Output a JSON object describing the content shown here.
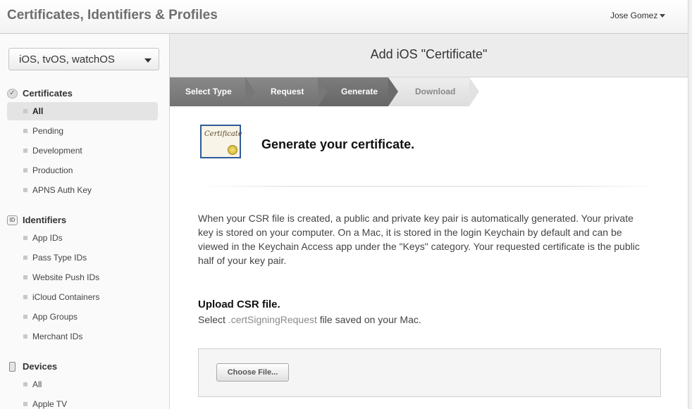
{
  "header": {
    "title": "Certificates, Identifiers & Profiles",
    "user": "Jose Gomez"
  },
  "sidebar": {
    "platform": "iOS, tvOS, watchOS",
    "certificates": {
      "label": "Certificates",
      "icon": "certificate-check-icon",
      "items": [
        "All",
        "Pending",
        "Development",
        "Production",
        "APNS Auth Key"
      ],
      "active": "All"
    },
    "identifiers": {
      "label": "Identifiers",
      "icon_text": "ID",
      "items": [
        "App IDs",
        "Pass Type IDs",
        "Website Push IDs",
        "iCloud Containers",
        "App Groups",
        "Merchant IDs"
      ]
    },
    "devices": {
      "label": "Devices",
      "icon": "device-icon",
      "items": [
        "All",
        "Apple TV"
      ]
    }
  },
  "main": {
    "title": "Add iOS \"Certificate\"",
    "steps": [
      "Select Type",
      "Request",
      "Generate",
      "Download"
    ],
    "current_step": "Generate",
    "cert_icon_text": "Certificate",
    "heading": "Generate your certificate.",
    "description": "When your CSR file is created, a public and private key pair is automatically generated. Your private key is stored on your computer. On a Mac, it is stored in the login Keychain by default and can be viewed in the Keychain Access app under the \"Keys\" category. Your requested certificate is the public half of your key pair.",
    "upload_heading": "Upload CSR file.",
    "upload_sub_prefix": "Select ",
    "upload_sub_code": ".certSigningRequest",
    "upload_sub_suffix": " file saved on your Mac.",
    "choose_button": "Choose File..."
  },
  "colors": {
    "step_done": "#7d7d7d",
    "step_current": "#6c6c6c",
    "step_future": "#e4e4e4",
    "cert_border": "#2f5b99"
  }
}
